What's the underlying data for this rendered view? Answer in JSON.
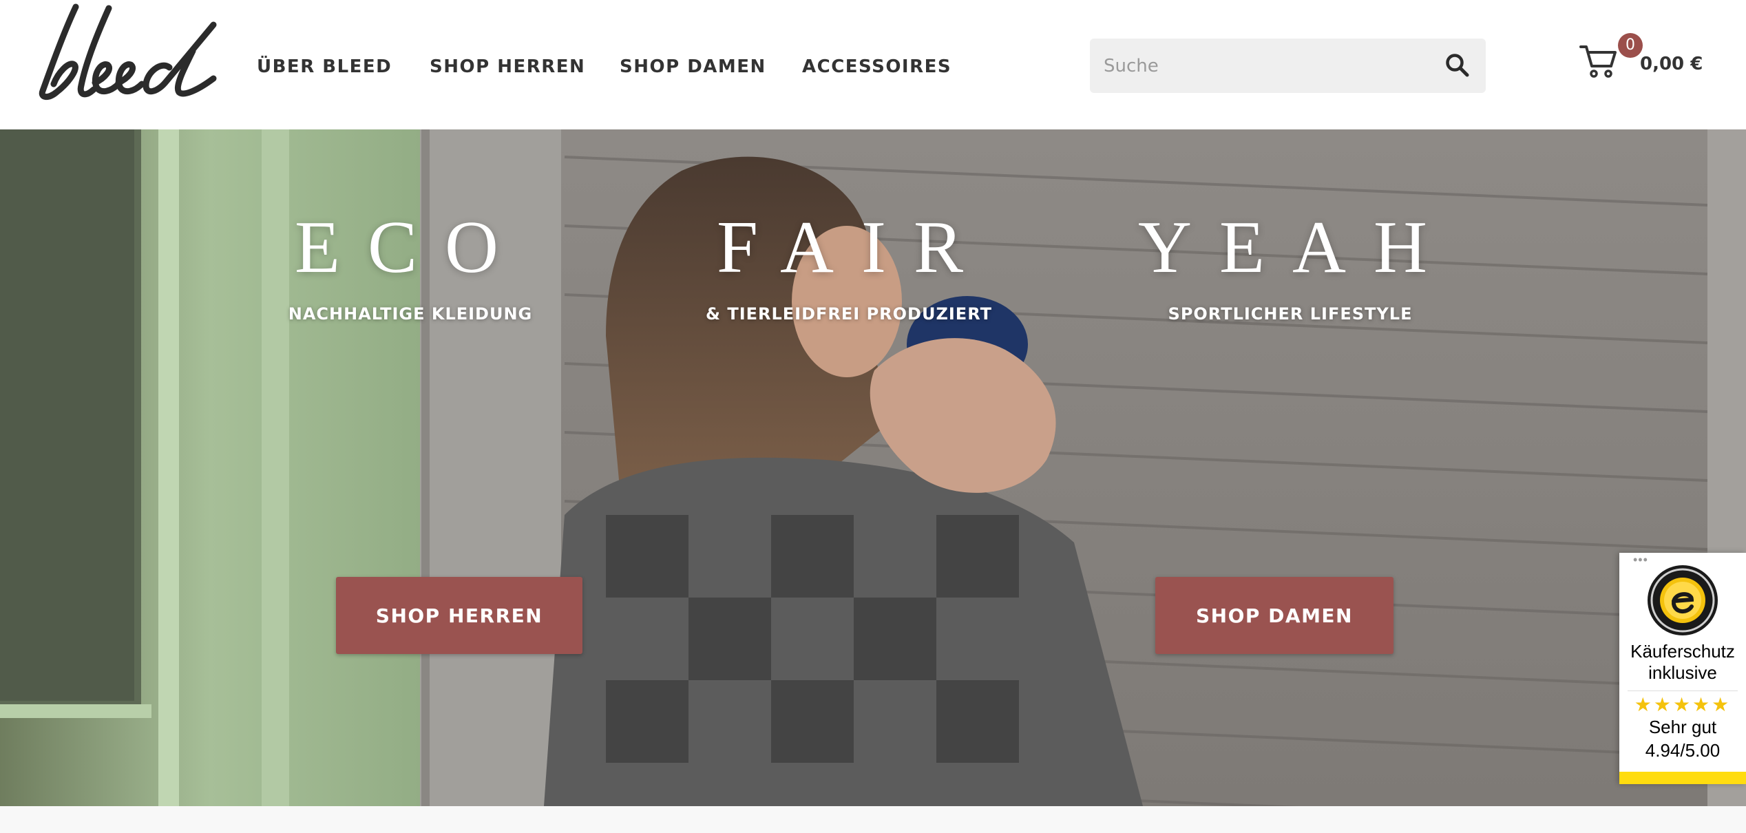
{
  "brand": {
    "logo_text": "bleed"
  },
  "nav": {
    "items": [
      {
        "label": "ÜBER BLEED"
      },
      {
        "label": "SHOP HERREN"
      },
      {
        "label": "SHOP DAMEN"
      },
      {
        "label": "ACCESSOIRES"
      }
    ]
  },
  "search": {
    "placeholder": "Suche",
    "value": ""
  },
  "cart": {
    "count": "0",
    "amount": "0,00 €"
  },
  "hero": {
    "claims": [
      {
        "title": "ECO",
        "subtitle": "NACHHALTIGE KLEIDUNG"
      },
      {
        "title": "FAIR",
        "subtitle": "& TIERLEIDFREI PRODUZIERT"
      },
      {
        "title": "YEAH",
        "subtitle": "SPORTLICHER LIFESTYLE"
      }
    ],
    "buttons": {
      "men": "SHOP HERREN",
      "women": "SHOP DAMEN"
    }
  },
  "trusted_shops": {
    "dots": "•••",
    "label": "Käuferschutz inklusive",
    "stars": "★★★★★",
    "rating_word": "Sehr gut",
    "score": "4.94/5.00"
  },
  "colors": {
    "accent": "#9a5350",
    "badge": "#9b4f4b",
    "text": "#333333",
    "trust_yellow": "#ffdc0f"
  }
}
